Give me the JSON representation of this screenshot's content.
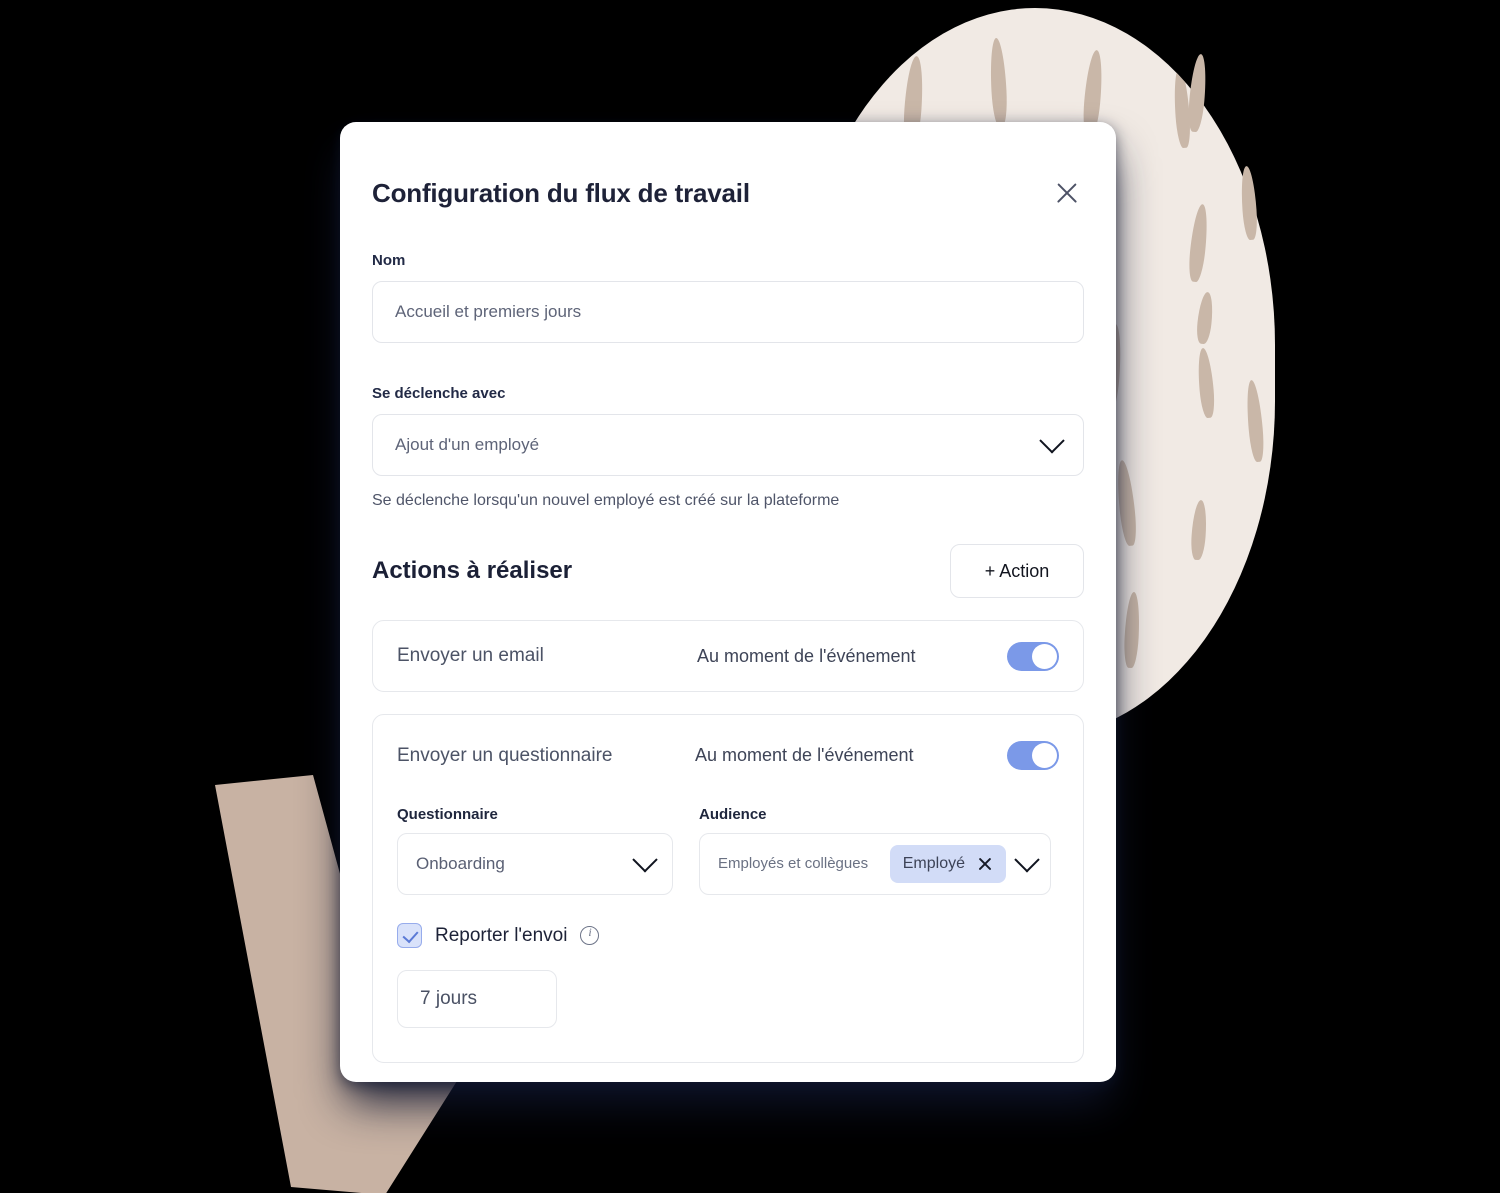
{
  "modal": {
    "title": "Configuration du flux de travail",
    "close_icon": "close-icon"
  },
  "name_field": {
    "label": "Nom",
    "value": "Accueil et premiers jours",
    "placeholder": "Accueil et premiers jours"
  },
  "trigger_field": {
    "label": "Se déclenche avec",
    "value": "Ajout d'un employé",
    "helper": "Se déclenche lorsqu'un nouvel employé est créé sur la plateforme",
    "chevron_icon": "chevron-down-icon"
  },
  "actions_section": {
    "title": "Actions à réaliser",
    "add_button": "+ Action"
  },
  "actions": [
    {
      "name": "Envoyer un email",
      "timing": "Au moment de l'événement",
      "enabled": true
    },
    {
      "name": "Envoyer un questionnaire",
      "timing": "Au moment de l'événement",
      "enabled": true,
      "questionnaire": {
        "label": "Questionnaire",
        "value": "Onboarding",
        "chevron_icon": "chevron-down-icon"
      },
      "audience": {
        "label": "Audience",
        "placeholder": "Employés et collègues",
        "chips": [
          {
            "text": "Employé",
            "remove_icon": "close-icon"
          }
        ],
        "chevron_icon": "chevron-down-icon"
      },
      "delay": {
        "checkbox_label": "Reporter l'envoi",
        "checked": true,
        "info_icon": "info-icon",
        "value": "7 jours"
      }
    }
  ],
  "colors": {
    "toggle_on": "#7b99e8",
    "chip_bg": "#d2dcf7",
    "checkbox_bg": "#d9e2fa",
    "checkbox_border": "#97acec",
    "card_bg": "#ffffff",
    "backdrop_circle": "#f1eae4",
    "backdrop_dash": "#c9b7a8",
    "backdrop_check": "#c8b2a3",
    "title_text": "#1e2238",
    "body_text": "#4f5569"
  }
}
